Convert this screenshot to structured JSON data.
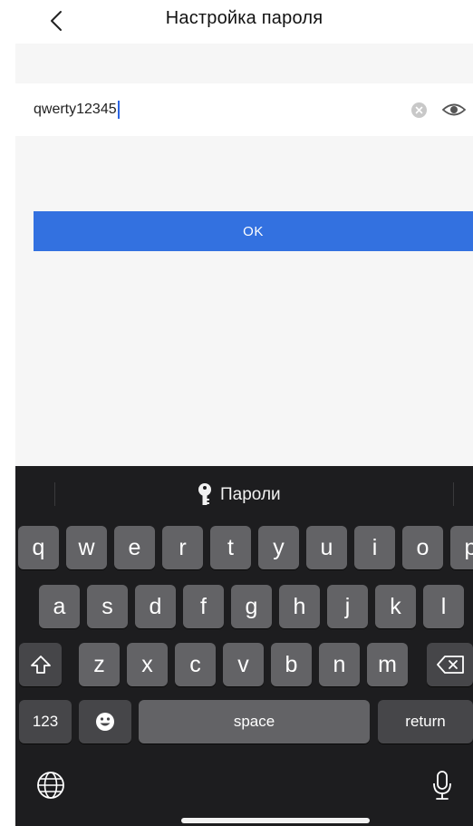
{
  "nav": {
    "title": "Настройка пароля",
    "back_icon": "chevron-left-icon"
  },
  "password_field": {
    "value": "qwerty12345",
    "clear_icon": "clear-circle-icon",
    "visibility_icon": "eye-icon"
  },
  "ok_button": {
    "label": "OK"
  },
  "keyboard": {
    "suggestion": {
      "label": "Пароли",
      "icon": "key-icon"
    },
    "rows": [
      [
        "q",
        "w",
        "e",
        "r",
        "t",
        "y",
        "u",
        "i",
        "o",
        "p"
      ],
      [
        "a",
        "s",
        "d",
        "f",
        "g",
        "h",
        "j",
        "k",
        "l"
      ],
      [
        "z",
        "x",
        "c",
        "v",
        "b",
        "n",
        "m"
      ]
    ],
    "numbers_label": "123",
    "space_label": "space",
    "return_label": "return",
    "shift_icon": "shift-icon",
    "delete_icon": "backspace-icon",
    "emoji_icon": "emoji-icon",
    "globe_icon": "globe-icon",
    "mic_icon": "microphone-icon"
  },
  "colors": {
    "accent": "#3371e0",
    "caret": "#2b64e3",
    "keyboard_bg": "#1d1d1f",
    "key_bg": "#636366",
    "key_dark_bg": "#464649",
    "page_bg": "#f6f6f6"
  }
}
